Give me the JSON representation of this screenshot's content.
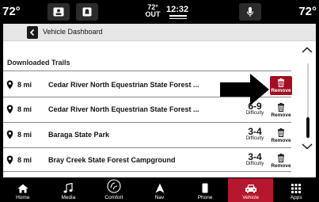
{
  "status_bar": {
    "temp_left": "72°",
    "temp_right": "72°",
    "outside_temp": "72°",
    "outside_label": "OUT",
    "time": "12:32"
  },
  "header": {
    "back_icon": "chevron-left-icon",
    "title": "Vehicle Dashboard"
  },
  "section": {
    "title": "Downloaded Trails"
  },
  "trails": [
    {
      "distance": "8 mi",
      "name": "Cedar River North Equestrian State Forest ...",
      "difficulty": "",
      "difficulty_label": "",
      "remove_label": "Remove",
      "remove_active": true
    },
    {
      "distance": "8 mi",
      "name": "Cedar River North Equestrian State Forest ...",
      "difficulty": "6-9",
      "difficulty_label": "Difficulty",
      "remove_label": "Remove",
      "remove_active": false
    },
    {
      "distance": "8 mi",
      "name": "Baraga State Park",
      "difficulty": "3-4",
      "difficulty_label": "Difficulty",
      "remove_label": "Remove",
      "remove_active": false
    },
    {
      "distance": "8 mi",
      "name": "Bray Creek State Forest Campground",
      "difficulty": "3-4",
      "difficulty_label": "Difficulty",
      "remove_label": "Remove",
      "remove_active": false
    }
  ],
  "bottom_nav": [
    {
      "label": "Home",
      "icon": "home-icon",
      "active": false
    },
    {
      "label": "Media",
      "icon": "music-note-icon",
      "active": false
    },
    {
      "label": "Comfort",
      "icon": "comfort-icon",
      "active": false
    },
    {
      "label": "Nav",
      "icon": "navigation-arrow-icon",
      "active": false
    },
    {
      "label": "Phone",
      "icon": "phone-icon",
      "active": false
    },
    {
      "label": "Vehicle",
      "icon": "vehicle-icon",
      "active": true
    },
    {
      "label": "Apps",
      "icon": "apps-grid-icon",
      "active": false
    }
  ],
  "colors": {
    "accent": "#a40e22",
    "nav_active": "#b5172f"
  }
}
